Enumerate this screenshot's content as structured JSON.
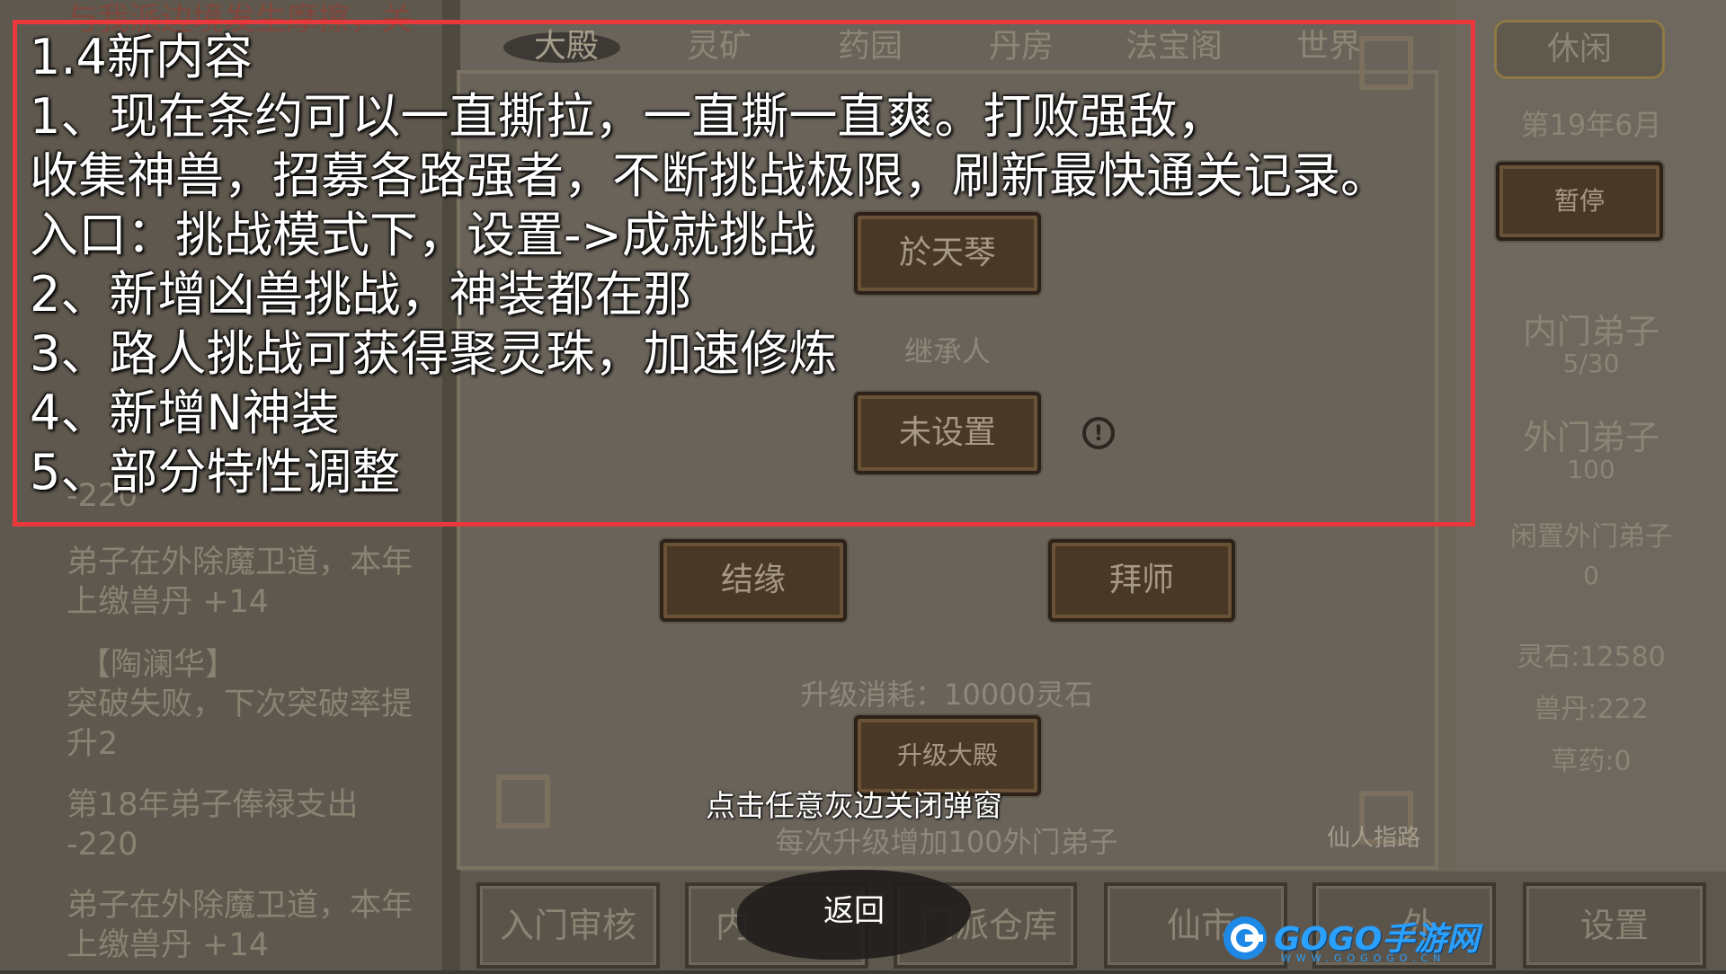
{
  "log": {
    "top_faded": "与我派边境发生摩擦，关",
    "entries": [
      {
        "text": "弟子在外除魔卫道，本年上缴兽丹 +14"
      },
      {
        "text": "【陶澜华】"
      },
      {
        "text": "突破失败，下次突破率提升2"
      },
      {
        "text": "第18年弟子俸禄支出 -220"
      },
      {
        "text": "弟子在外除魔卫道，本年上缴兽丹 +14"
      }
    ],
    "entry_partial": "-220"
  },
  "tabs": [
    "大殿",
    "灵矿",
    "药园",
    "丹房",
    "法宝阁",
    "世界"
  ],
  "center": {
    "master_name": "於天琴",
    "heir_label": "继承人",
    "heir_value": "未设置",
    "info_icon": "exclamation-circle-icon",
    "marry_button": "结缘",
    "apprentice_button": "拜师",
    "upgrade_cost": "升级消耗：10000灵石",
    "upgrade_button": "升级大殿",
    "upgrade_note": "每次升级增加100外门弟子",
    "hint_text": "仙人指路"
  },
  "right": {
    "mode_button": "休闲",
    "date": "第19年6月",
    "pause_button": "暂停",
    "inner_label": "内门弟子",
    "inner_value": "5/30",
    "outer_label": "外门弟子",
    "outer_value": "100",
    "idle_label": "闲置外门弟子",
    "idle_value": "0",
    "stones": "灵石:12580",
    "beast_pills": "兽丹:222",
    "herbs": "草药:0"
  },
  "bottom": {
    "buttons": [
      "入门审核",
      "内",
      "门派仓库",
      "仙市",
      "外",
      "设置"
    ]
  },
  "notice": {
    "lines": [
      "1.4新内容",
      "1、现在条约可以一直撕拉，一直撕一直爽。打败强敌，",
      "收集神兽，招募各路强者，不断挑战极限，刷新最快通关记录。",
      "入口：挑战模式下，设置->成就挑战",
      "2、新增凶兽挑战，神装都在那",
      "3、路人挑战可获得聚灵珠，加速修炼",
      "4、新增N神装",
      "5、部分特性调整"
    ],
    "border_color": "#e8383b"
  },
  "close_hint": "点击任意灰边关闭弹窗",
  "back_button": "返回",
  "watermark": {
    "brand": "GOGO手游网",
    "url": "WWW.GOGOGO.CN"
  }
}
